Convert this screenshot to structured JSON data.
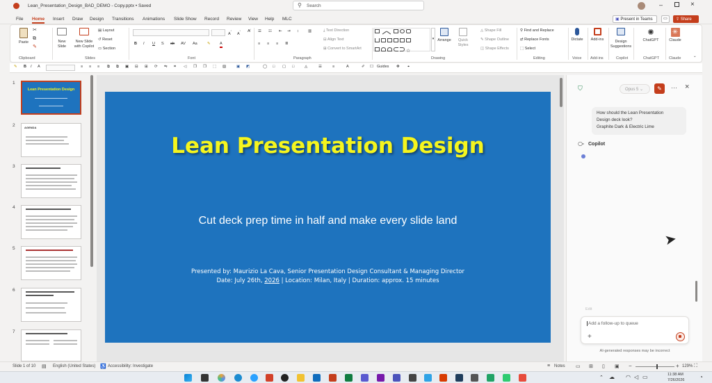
{
  "window": {
    "file_title": "Lean_Presentation_Design_BAD_DEMO - Copy.pptx • Saved",
    "search_placeholder": "Search"
  },
  "menu": {
    "tabs": [
      "File",
      "Home",
      "Insert",
      "Draw",
      "Design",
      "Transitions",
      "Animations",
      "Slide Show",
      "Record",
      "Review",
      "View",
      "Help",
      "MLC"
    ],
    "present_in_teams": "Present in Teams",
    "share": "Share"
  },
  "ribbon": {
    "paste": "Paste",
    "new_slide": "New Slide",
    "new_slide_copilot": "New Slide with Copilot",
    "layout": "Layout",
    "reset": "Reset",
    "section": "Section",
    "text_direction": "Text Direction",
    "align_text": "Align Text",
    "convert_smartart": "Convert to SmartArt",
    "arrange": "Arrange",
    "quick_styles": "Quick Styles",
    "shape_fill": "Shape Fill",
    "shape_outline": "Shape Outline",
    "shape_effects": "Shape Effects",
    "find_replace": "Find and Replace",
    "replace_fonts": "Replace Fonts",
    "select": "Select",
    "dictate": "Dictate",
    "addins": "Add-ins",
    "design_suggestions": "Design Suggestions",
    "chatgpt": "ChatGPT",
    "claude": "Claude",
    "groups": {
      "clipboard": "Clipboard",
      "slides": "Slides",
      "font": "Font",
      "paragraph": "Paragraph",
      "drawing": "Drawing",
      "editing": "Editing",
      "voice": "Voice",
      "addins": "Add-ins",
      "copilot": "Copilot",
      "chatgpt": "ChatGPT",
      "claude": "Claude"
    },
    "guides": "Guides"
  },
  "thumbnails": {
    "numbers": [
      "1",
      "2",
      "3",
      "4",
      "5",
      "6",
      "7"
    ],
    "t1_title": "Lean Presentation Design",
    "t2_title": "AGENDA"
  },
  "slide": {
    "title": "Lean Presentation Design",
    "subtitle": "Cut deck prep time in half and make every slide land",
    "presenter_line": "Presented by: Maurizio La Cava, Senior Presentation Design Consultant & Managing Director",
    "date_line_prefix": "Date: July 26th, ",
    "date_year": "2026",
    "date_line_suffix": " | Location: Milan, Italy | Duration: approx. 15 minutes"
  },
  "copilot": {
    "model": "Opus 5",
    "user_message_1": "How should the Lean Presentation",
    "user_message_2": "Design deck look?",
    "user_message_3": "Graphite Dark & Electric Lime",
    "assistant_name": "Copilot",
    "edit_label": "Edit",
    "followup_placeholder": "Add a follow-up to queue",
    "disclaimer": "AI-generated responses may be incorrect"
  },
  "status": {
    "slide_count": "Slide 1 of 10",
    "language": "English (United States)",
    "accessibility": "Accessibility: Investigate",
    "notes": "Notes",
    "zoom": "129%"
  },
  "taskbar": {
    "time": "11:38 AM",
    "date": "7/26/2026"
  },
  "colors": {
    "accent": "#c43e1c",
    "slide_bg": "#1e73be",
    "title_yellow": "#f5f51e"
  }
}
